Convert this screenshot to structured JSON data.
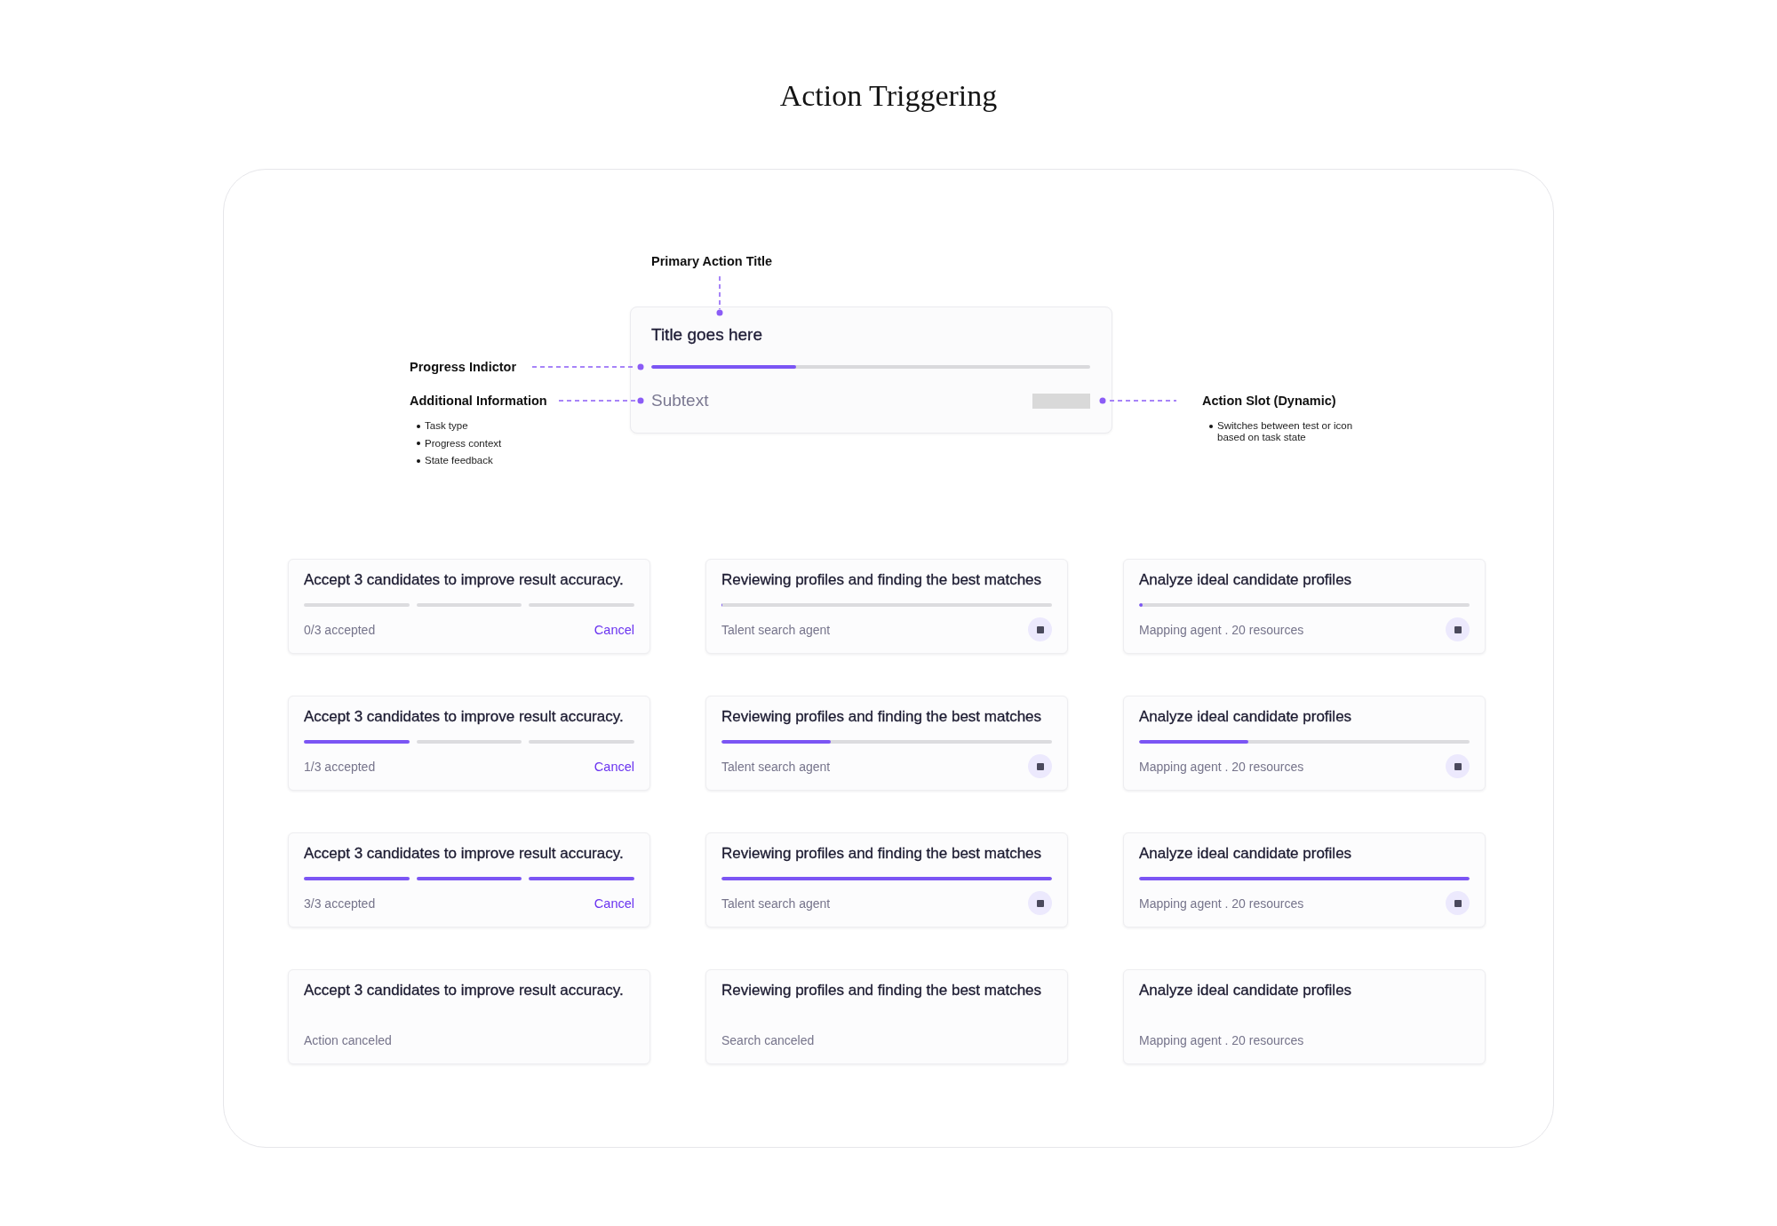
{
  "page_title": "Action Triggering",
  "anatomy": {
    "top_annotation": {
      "label": "Primary Action Title"
    },
    "left_annotations": [
      {
        "label": "Progress Indictor"
      },
      {
        "label": "Additional Information",
        "bullets": [
          "Task type",
          "Progress context",
          "State feedback"
        ]
      }
    ],
    "right_annotation": {
      "label": "Action Slot (Dynamic)",
      "bullets": [
        "Switches between test or icon based on task state"
      ]
    },
    "card": {
      "title": "Title goes here",
      "level": 0.33,
      "subtext": "Subtext"
    }
  },
  "cards": [
    {
      "title": "Accept 3 candidates to improve result accuracy.",
      "progress": {
        "kind": "segmented",
        "segments": [
          {
            "filled": false
          },
          {
            "filled": false
          },
          {
            "filled": false
          }
        ]
      },
      "subtext": "0/3 accepted",
      "action": {
        "kind": "link",
        "label": "Cancel"
      }
    },
    {
      "title": "Reviewing profiles and finding the best matches",
      "progress": {
        "kind": "bar",
        "level": 0
      },
      "subtext": "Talent search agent",
      "action": {
        "kind": "stop"
      }
    },
    {
      "title": "Analyze ideal candidate profiles",
      "progress": {
        "kind": "bar",
        "level": 0.01
      },
      "subtext": "Mapping agent . 20 resources",
      "action": {
        "kind": "stop"
      }
    },
    {
      "title": "Accept 3 candidates to improve result accuracy.",
      "progress": {
        "kind": "segmented",
        "segments": [
          {
            "filled": true
          },
          {
            "filled": false
          },
          {
            "filled": false
          }
        ]
      },
      "subtext": "1/3 accepted",
      "action": {
        "kind": "link",
        "label": "Cancel"
      }
    },
    {
      "title": "Reviewing profiles and finding the best matches",
      "progress": {
        "kind": "bar",
        "level": 0.33
      },
      "subtext": "Talent search agent",
      "action": {
        "kind": "stop"
      }
    },
    {
      "title": "Analyze ideal candidate profiles",
      "progress": {
        "kind": "bar",
        "level": 0.33
      },
      "subtext": "Mapping agent . 20 resources",
      "action": {
        "kind": "stop"
      }
    },
    {
      "title": "Accept 3 candidates to improve result accuracy.",
      "progress": {
        "kind": "segmented",
        "segments": [
          {
            "filled": true
          },
          {
            "filled": true
          },
          {
            "filled": true
          }
        ]
      },
      "subtext": "3/3 accepted",
      "action": {
        "kind": "link",
        "label": "Cancel"
      }
    },
    {
      "title": "Reviewing profiles and finding the best matches",
      "progress": {
        "kind": "bar",
        "level": 1
      },
      "subtext": "Talent search agent",
      "action": {
        "kind": "stop"
      }
    },
    {
      "title": "Analyze ideal candidate profiles",
      "progress": {
        "kind": "bar",
        "level": 1
      },
      "subtext": "Mapping agent . 20 resources",
      "action": {
        "kind": "stop"
      }
    },
    {
      "title": "Accept 3 candidates to improve result accuracy.",
      "subtext": "Action canceled"
    },
    {
      "title": "Reviewing profiles and finding the best matches",
      "subtext": "Search canceled"
    },
    {
      "title": "Analyze ideal candidate profiles",
      "subtext": "Mapping agent . 20 resources"
    }
  ]
}
